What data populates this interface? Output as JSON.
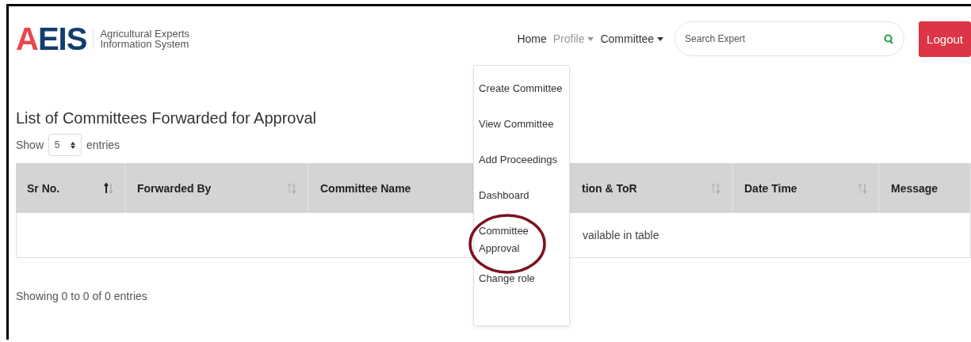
{
  "logo": {
    "mark_first": "A",
    "mark_rest": "EIS",
    "subtitle_line1": "Agricultural Experts",
    "subtitle_line2": "Information System"
  },
  "nav": [
    {
      "label": "Home",
      "kind": "link",
      "dimmed": false
    },
    {
      "label": "Profile",
      "kind": "dropdown",
      "dimmed": true
    },
    {
      "label": "Committee",
      "kind": "dropdown",
      "dimmed": false
    }
  ],
  "search": {
    "placeholder": "Search Expert"
  },
  "logout_button": "Logout",
  "menu": [
    {
      "label": "Create Committee",
      "circled": false
    },
    {
      "label": "View Committee",
      "circled": false
    },
    {
      "label": "Add Proceedings",
      "circled": false
    },
    {
      "label": "Dashboard",
      "circled": false
    },
    {
      "label": "Committee Approval",
      "circled": true
    },
    {
      "label": "Change role",
      "circled": false
    }
  ],
  "page_title": "List of Committees Forwarded for Approval",
  "length_control": {
    "before": "Show",
    "value": "5",
    "after": "entries"
  },
  "table": {
    "columns": [
      {
        "label": "Sr No.",
        "sorted": true
      },
      {
        "label": "Forwarded By",
        "sorted": false
      },
      {
        "label": "Committee Name"
      },
      {
        "label": "tion & ToR",
        "sorted": false
      },
      {
        "label": "Date Time",
        "sorted": false
      },
      {
        "label": "Message"
      }
    ],
    "empty_message": "vailable in table"
  },
  "info": "Showing 0 to 0 of 0 entries"
}
